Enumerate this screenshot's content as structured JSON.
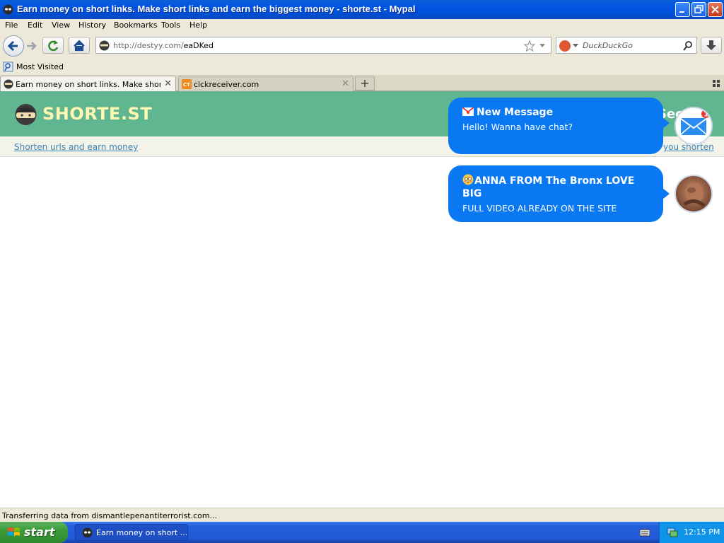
{
  "window": {
    "title": "Earn money on short links. Make short links and earn the biggest money - shorte.st - Mypal"
  },
  "menu": [
    "File",
    "Edit",
    "View",
    "History",
    "Bookmarks",
    "Tools",
    "Help"
  ],
  "navbar": {
    "url_prefix": "http://destyy.com/",
    "url_path": "eaDKed",
    "search_placeholder": "DuckDuckGo"
  },
  "bookmarks": {
    "most_visited": "Most Visited"
  },
  "tabs": [
    {
      "label": "Earn money on short links. Make short lin...",
      "active": true
    },
    {
      "label": "clckreceiver.com",
      "active": false
    }
  ],
  "site": {
    "logo_text": "SHORTE.ST",
    "header_cut_text": "Sec",
    "sub_link_left": "Shorten urls and earn money",
    "sub_link_right": "you shorten"
  },
  "notifications": [
    {
      "title": "New Message",
      "text": "Hello! Wanna have chat?",
      "badge_count": "1"
    },
    {
      "title": "ANNA FROM The Bronx LOVE BIG",
      "text": "FULL VIDEO ALREADY ON THE SITE"
    }
  ],
  "status": {
    "text": "Transferring data from dismantlepenantiterrorist.com..."
  },
  "taskbar": {
    "start_label": "start",
    "task_label": "Earn money on short ...",
    "clock": "12:15 PM"
  },
  "colors": {
    "site_header": "#5fb690",
    "notification_blue": "#0a78f2",
    "titlebar_blue": "#0054e3"
  }
}
